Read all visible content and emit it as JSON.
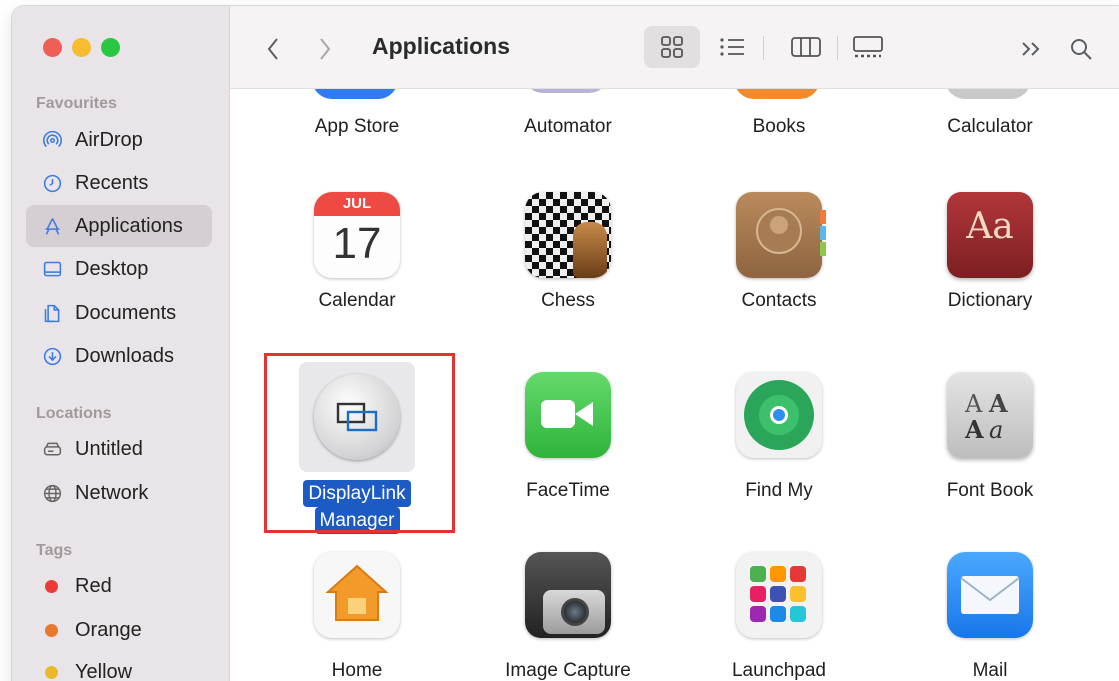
{
  "window": {
    "title": "Applications"
  },
  "sidebar": {
    "favourites_heading": "Favourites",
    "favourites": [
      {
        "label": "AirDrop",
        "icon": "airdrop-icon"
      },
      {
        "label": "Recents",
        "icon": "clock-icon"
      },
      {
        "label": "Applications",
        "icon": "applications-icon",
        "active": true
      },
      {
        "label": "Desktop",
        "icon": "desktop-icon"
      },
      {
        "label": "Documents",
        "icon": "document-icon"
      },
      {
        "label": "Downloads",
        "icon": "download-icon"
      }
    ],
    "locations_heading": "Locations",
    "locations": [
      {
        "label": "Untitled",
        "icon": "drive-icon"
      },
      {
        "label": "Network",
        "icon": "network-icon"
      }
    ],
    "tags_heading": "Tags",
    "tags": [
      {
        "label": "Red",
        "color": "#eb3b35"
      },
      {
        "label": "Orange",
        "color": "#e8792a"
      },
      {
        "label": "Yellow",
        "color": "#e8b92a"
      }
    ]
  },
  "toolbar": {
    "title": "Applications",
    "views": [
      "icon-view",
      "list-view",
      "column-view",
      "gallery-view"
    ],
    "active_view": "icon-view"
  },
  "apps": [
    {
      "label": "App Store",
      "icon": "app-store-icon"
    },
    {
      "label": "Automator",
      "icon": "automator-icon"
    },
    {
      "label": "Books",
      "icon": "books-icon"
    },
    {
      "label": "Calculator",
      "icon": "calculator-icon"
    },
    {
      "label": "Calendar",
      "icon": "calendar-icon",
      "month": "JUL",
      "day": "17"
    },
    {
      "label": "Chess",
      "icon": "chess-icon"
    },
    {
      "label": "Contacts",
      "icon": "contacts-icon"
    },
    {
      "label": "Dictionary",
      "icon": "dictionary-icon",
      "glyph": "Aa"
    },
    {
      "label_line1": "DisplayLink",
      "label_line2": "Manager",
      "icon": "displaylink-manager-icon",
      "selected": true
    },
    {
      "label": "FaceTime",
      "icon": "facetime-icon"
    },
    {
      "label": "Find My",
      "icon": "find-my-icon"
    },
    {
      "label": "Font Book",
      "icon": "font-book-icon"
    },
    {
      "label": "Home",
      "icon": "home-icon"
    },
    {
      "label": "Image Capture",
      "icon": "image-capture-icon"
    },
    {
      "label": "Launchpad",
      "icon": "launchpad-icon"
    },
    {
      "label": "Mail",
      "icon": "mail-icon"
    }
  ],
  "colors": {
    "selection": "#1c5bc4",
    "highlight_box": "#e03333",
    "sidebar_bg": "#e9e4e7"
  }
}
